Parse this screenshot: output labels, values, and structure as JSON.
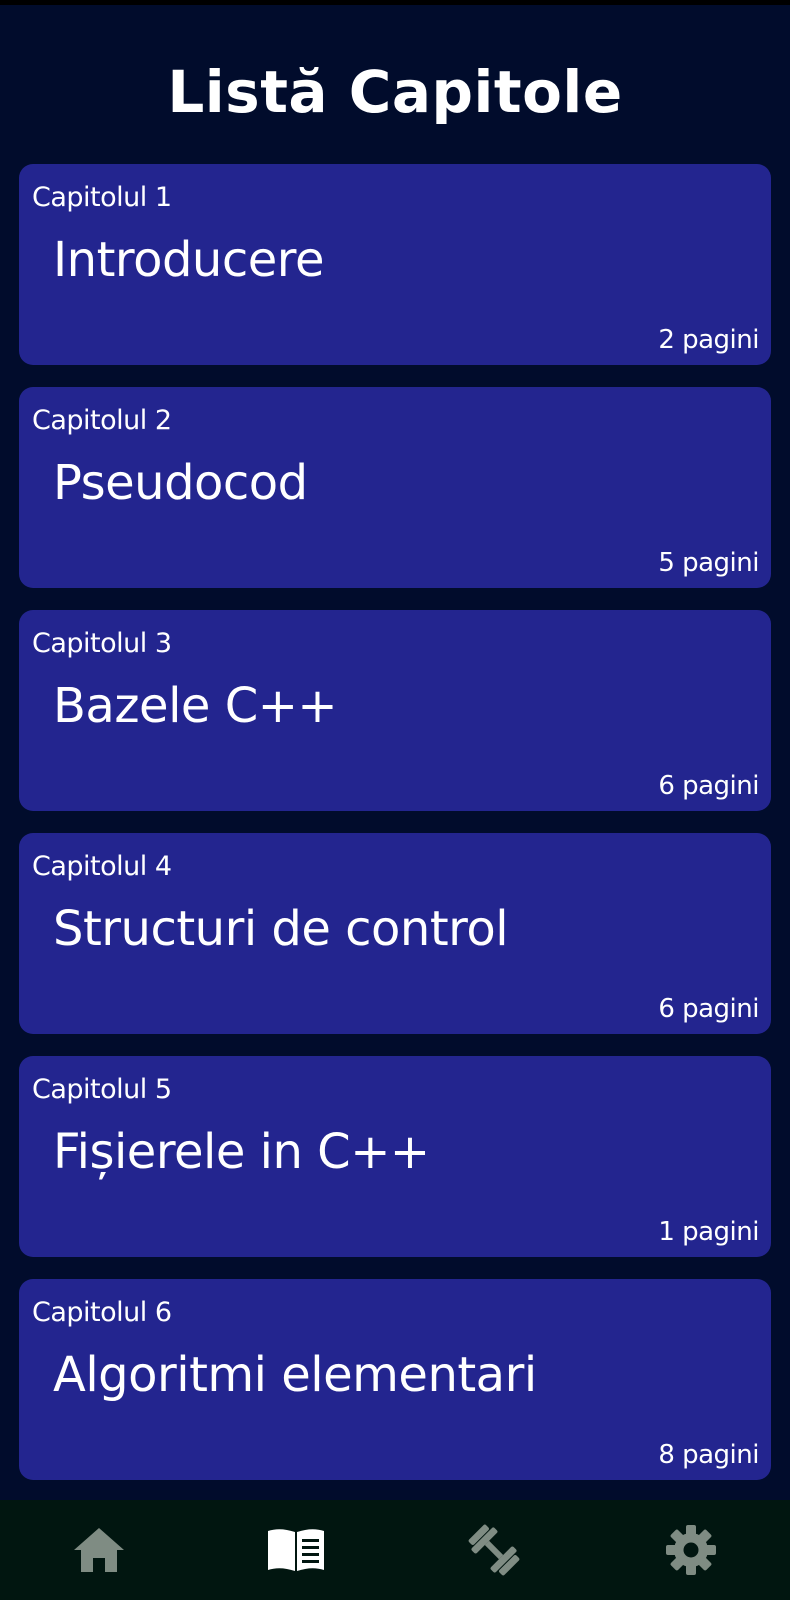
{
  "header": {
    "title": "Listă Capitole"
  },
  "chapters": [
    {
      "number": "Capitolul 1",
      "title": "Introducere",
      "pages": "2 pagini"
    },
    {
      "number": "Capitolul 2",
      "title": "Pseudocod",
      "pages": "5 pagini"
    },
    {
      "number": "Capitolul 3",
      "title": "Bazele C++",
      "pages": "6 pagini"
    },
    {
      "number": "Capitolul 4",
      "title": "Structuri de control",
      "pages": "6 pagini"
    },
    {
      "number": "Capitolul 5",
      "title": "Fișierele in C++",
      "pages": "1 pagini"
    },
    {
      "number": "Capitolul 6",
      "title": "Algoritmi elementari",
      "pages": "8 pagini"
    }
  ],
  "bottom_nav": {
    "items": [
      {
        "icon": "home-icon",
        "active": false
      },
      {
        "icon": "book-icon",
        "active": true
      },
      {
        "icon": "dumbbell-icon",
        "active": false
      },
      {
        "icon": "gear-icon",
        "active": false
      }
    ]
  },
  "colors": {
    "background": "#010c2c",
    "card": "#23258f",
    "nav_background": "#011610",
    "nav_icon_inactive": "#7f8c83",
    "nav_icon_active": "#ffffff",
    "text": "#ffffff"
  }
}
